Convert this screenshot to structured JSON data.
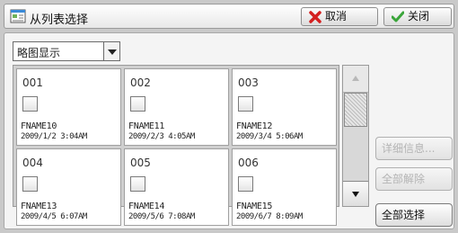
{
  "header": {
    "title": "从列表选择",
    "cancel_label": "取消",
    "close_label": "关闭"
  },
  "view_selector": {
    "selected": "略图显示"
  },
  "files": [
    {
      "number": "001",
      "name": "FNAME10",
      "date": "2009/1/2 3:04AM"
    },
    {
      "number": "002",
      "name": "FNAME11",
      "date": "2009/2/3 4:05AM"
    },
    {
      "number": "003",
      "name": "FNAME12",
      "date": "2009/3/4 5:06AM"
    },
    {
      "number": "004",
      "name": "FNAME13",
      "date": "2009/4/5 6:07AM"
    },
    {
      "number": "005",
      "name": "FNAME14",
      "date": "2009/5/6 7:08AM"
    },
    {
      "number": "006",
      "name": "FNAME15",
      "date": "2009/6/7 8:09AM"
    }
  ],
  "side_buttons": {
    "details_label": "详细信息...",
    "clear_all_label": "全部解除",
    "select_all_label": "全部选择"
  },
  "colors": {
    "cancel_icon": "#d42020",
    "close_icon": "#3aa53a"
  }
}
